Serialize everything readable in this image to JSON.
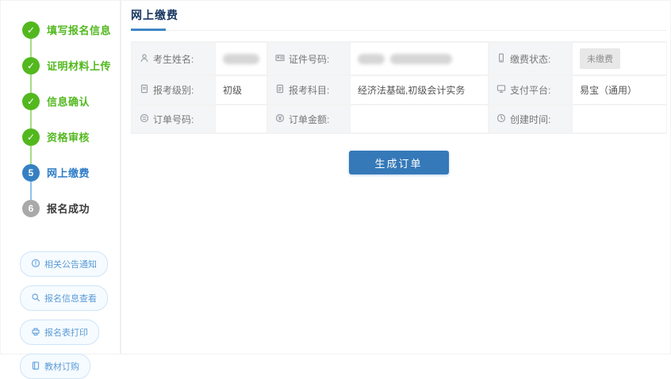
{
  "colors": {
    "accent_blue": "#3580c2",
    "button_blue": "#3579b8",
    "success_green": "#52b81e",
    "pending_gray": "#a9a9a9",
    "badge_bg": "#e8e8e8",
    "label_cell_bg": "#f4f5f7"
  },
  "stepper": {
    "check_glyph": "✓",
    "steps": [
      {
        "number": "1",
        "label": "填写报名信息",
        "status": "done"
      },
      {
        "number": "2",
        "label": "证明材料上传",
        "status": "done"
      },
      {
        "number": "3",
        "label": "信息确认",
        "status": "done"
      },
      {
        "number": "4",
        "label": "资格审核",
        "status": "done"
      },
      {
        "number": "5",
        "label": "网上缴费",
        "status": "current"
      },
      {
        "number": "6",
        "label": "报名成功",
        "status": "pending"
      }
    ]
  },
  "quick_links": [
    {
      "label": "相关公告通知",
      "icon": "announcement-icon"
    },
    {
      "label": "报名信息查看",
      "icon": "search-icon"
    },
    {
      "label": "报名表打印",
      "icon": "printer-icon"
    },
    {
      "label": "教材订购",
      "icon": "book-icon"
    }
  ],
  "payment_panel": {
    "tab_label": "网上缴费",
    "fields": [
      {
        "label": "考生姓名:",
        "value": "",
        "icon": "person-icon",
        "redacted": true
      },
      {
        "label": "证件号码:",
        "value": "",
        "icon": "id-card-icon",
        "redacted": true
      },
      {
        "label": "缴费状态:",
        "value": "未缴费",
        "icon": "payment-status-icon",
        "badge": true
      },
      {
        "label": "报考级别:",
        "value": "初级",
        "icon": "level-icon"
      },
      {
        "label": "报考科目:",
        "value": "经济法基础,初级会计实务",
        "icon": "subject-icon"
      },
      {
        "label": "支付平台:",
        "value": "易宝（通用）",
        "icon": "platform-icon"
      },
      {
        "label": "订单号码:",
        "value": "",
        "icon": "order-number-icon"
      },
      {
        "label": "订单金额:",
        "value": "",
        "icon": "order-amount-icon"
      },
      {
        "label": "创建时间:",
        "value": "",
        "icon": "create-time-icon"
      }
    ],
    "generate_button_label": "生成订单"
  }
}
